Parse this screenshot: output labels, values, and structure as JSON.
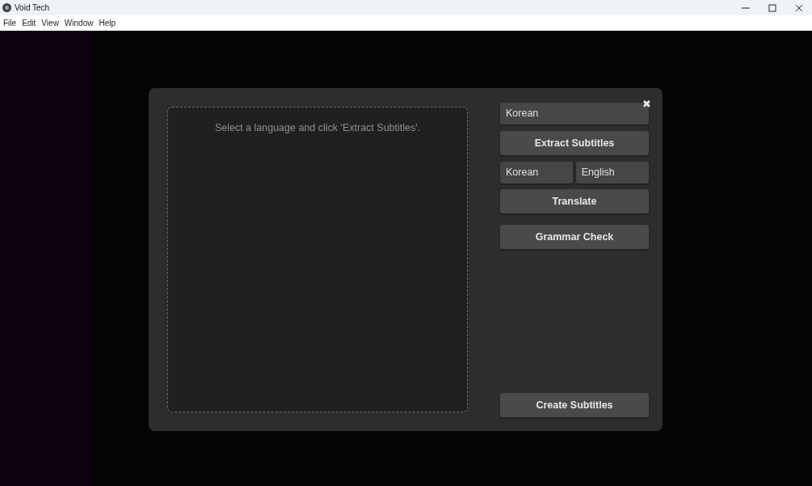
{
  "window": {
    "title": "Void Tech"
  },
  "menu": [
    "File",
    "Edit",
    "View",
    "Window",
    "Help"
  ],
  "dialog": {
    "close": "✖",
    "drop_area": {
      "message": "Select a language and click 'Extract Subtitles'."
    },
    "source_language": "Korean",
    "extract_button": "Extract Subtitles",
    "translate_from": "Korean",
    "translate_to": "English",
    "translate_button": "Translate",
    "grammar_button": "Grammar Check",
    "create_button": "Create Subtitles"
  }
}
